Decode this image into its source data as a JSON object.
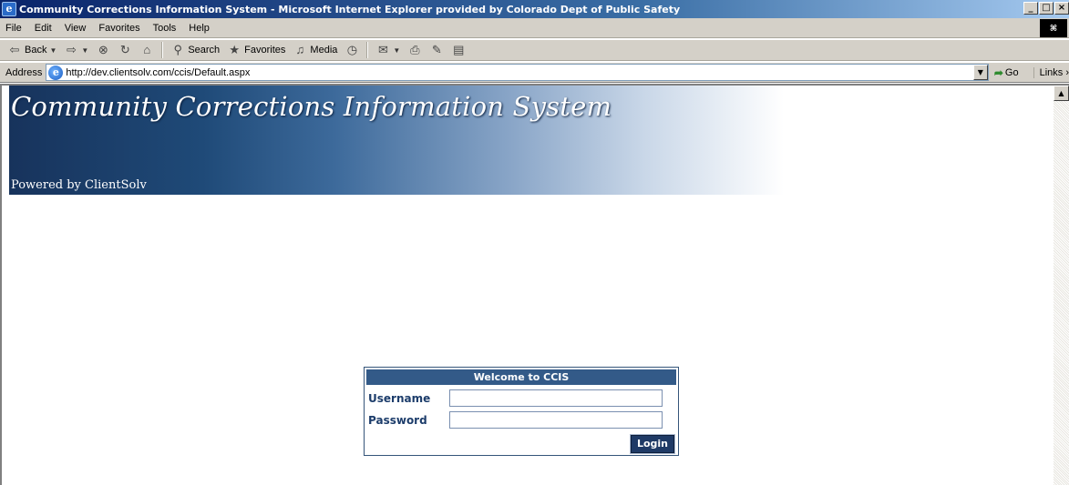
{
  "window": {
    "title": "Community Corrections Information System - Microsoft Internet Explorer provided by Colorado Dept of Public Safety",
    "buttons": [
      "_",
      "Б",
      "×"
    ]
  },
  "menu": {
    "items": [
      "File",
      "Edit",
      "View",
      "Favorites",
      "Tools",
      "Help"
    ],
    "brand_logo": "笻"
  },
  "toolbar": {
    "back_label": "Back",
    "search_label": "Search",
    "favorites_label": "Favorites",
    "media_label": "Media"
  },
  "address": {
    "label": "Address",
    "url": "http://dev.clientsolv.com/ccis/Default.aspx",
    "go_label": "Go",
    "links_label": "Links ›"
  },
  "banner": {
    "title": "Community Corrections Information System",
    "subtitle": "Powered by ClientSolv"
  },
  "login": {
    "heading": "Welcome to CCIS",
    "username_label": "Username",
    "password_label": "Password",
    "username_value": "",
    "password_value": "",
    "submit_label": "Login"
  },
  "colors": {
    "login_header": "#335a88",
    "banner_dark": "#17335c"
  }
}
